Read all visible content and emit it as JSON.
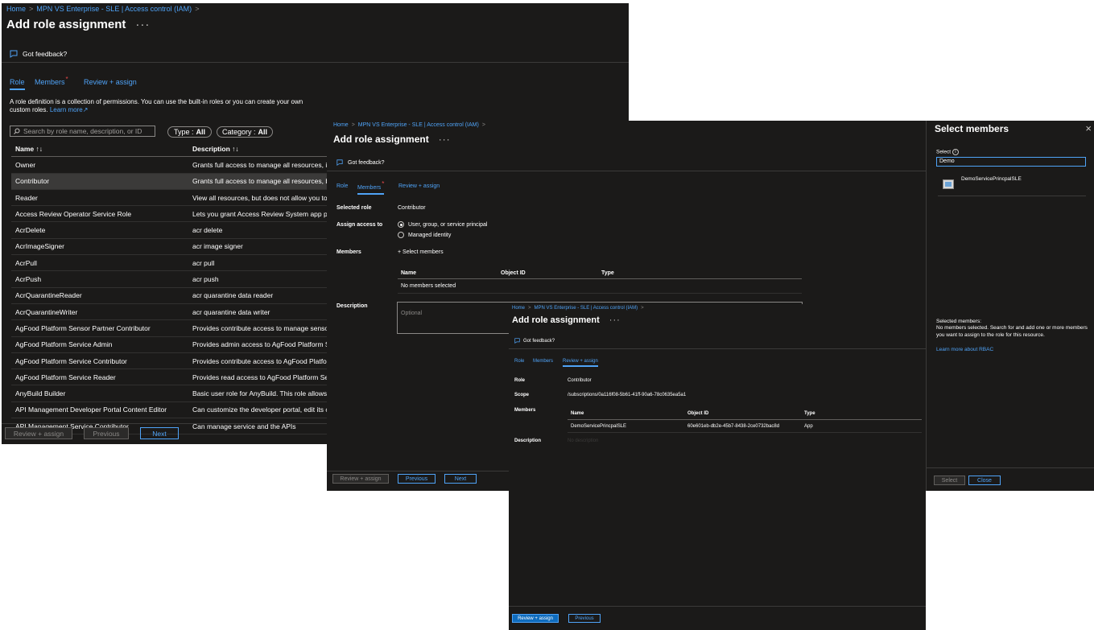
{
  "panel1": {
    "breadcrumb": [
      "Home",
      "MPN VS Enterprise - SLE | Access control (IAM)"
    ],
    "title": "Add role assignment",
    "ellipsis": "···",
    "feedback": "Got feedback?",
    "tabs": {
      "role": "Role",
      "members": "Members",
      "review": "Review + assign"
    },
    "intro": "A role definition is a collection of permissions. You can use the built-in roles or you can create your own custom roles.",
    "learn_more": "Learn more",
    "search_placeholder": "Search by role name, description, or ID",
    "filter_type": {
      "label": "Type :",
      "value": "All"
    },
    "filter_category": {
      "label": "Category :",
      "value": "All"
    },
    "columns": {
      "name": "Name ↑↓",
      "description": "Description ↑↓"
    },
    "rows": [
      {
        "name": "Owner",
        "description": "Grants full access to manage all resources, incluc"
      },
      {
        "name": "Contributor",
        "description": "Grants full access to manage all resources, but d"
      },
      {
        "name": "Reader",
        "description": "View all resources, but does not allow you to ma"
      },
      {
        "name": "Access Review Operator Service Role",
        "description": "Lets you grant Access Review System app permis"
      },
      {
        "name": "AcrDelete",
        "description": "acr delete"
      },
      {
        "name": "AcrImageSigner",
        "description": "acr image signer"
      },
      {
        "name": "AcrPull",
        "description": "acr pull"
      },
      {
        "name": "AcrPush",
        "description": "acr push"
      },
      {
        "name": "AcrQuarantineReader",
        "description": "acr quarantine data reader"
      },
      {
        "name": "AcrQuarantineWriter",
        "description": "acr quarantine data writer"
      },
      {
        "name": "AgFood Platform Sensor Partner Contributor",
        "description": "Provides contribute access to manage sensor rel"
      },
      {
        "name": "AgFood Platform Service Admin",
        "description": "Provides admin access to AgFood Platform Servi"
      },
      {
        "name": "AgFood Platform Service Contributor",
        "description": "Provides contribute access to AgFood Platform S"
      },
      {
        "name": "AgFood Platform Service Reader",
        "description": "Provides read access to AgFood Platform Service"
      },
      {
        "name": "AnyBuild Builder",
        "description": "Basic user role for AnyBuild. This role allows listi"
      },
      {
        "name": "API Management Developer Portal Content Editor",
        "description": "Can customize the developer portal, edit its cont"
      },
      {
        "name": "API Management Service Contributor",
        "description": "Can manage service and the APIs"
      }
    ],
    "buttons": {
      "review": "Review + assign",
      "previous": "Previous",
      "next": "Next"
    }
  },
  "panel2": {
    "breadcrumb": [
      "Home",
      "MPN VS Enterprise - SLE | Access control (IAM)"
    ],
    "title": "Add role assignment",
    "ellipsis": "···",
    "feedback": "Got feedback?",
    "tabs": {
      "role": "Role",
      "members": "Members",
      "review": "Review + assign"
    },
    "selected_role_label": "Selected role",
    "selected_role_value": "Contributor",
    "assign_access_label": "Assign access to",
    "option_user": "User, group, or service principal",
    "option_managed": "Managed identity",
    "members_label": "Members",
    "select_members_link": "+ Select members",
    "columns": {
      "name": "Name",
      "object_id": "Object ID",
      "type": "Type"
    },
    "empty": "No members selected",
    "description_label": "Description",
    "description_placeholder": "Optional",
    "buttons": {
      "review": "Review + assign",
      "previous": "Previous",
      "next": "Next"
    }
  },
  "panel3": {
    "breadcrumb": [
      "Home",
      "MPN VS Enterprise - SLE | Access control (IAM)"
    ],
    "title": "Add role assignment",
    "ellipsis": "···",
    "feedback": "Got feedback?",
    "tabs": {
      "role": "Role",
      "members": "Members",
      "review": "Review + assign"
    },
    "role_label": "Role",
    "role_value": "Contributor",
    "scope_label": "Scope",
    "scope_value": "/subscriptions/0a116f08-5b61-41ff-90a6-78c0635ea5a1",
    "members_label": "Members",
    "columns": {
      "name": "Name",
      "object_id": "Object ID",
      "type": "Type"
    },
    "member_row": {
      "name": "DemoServicePrincpalSLE",
      "object_id": "60e601eb-db2e-45b7-8438-2ce0732bac8d",
      "type": "App"
    },
    "description_label": "Description",
    "description_value": "No description",
    "buttons": {
      "review": "Review + assign",
      "previous": "Previous"
    }
  },
  "panel4": {
    "title": "Select members",
    "close_glyph": "×",
    "select_label": "Select",
    "search_value": "Demo",
    "result_name": "DemoServicePrincpalSLE",
    "selected_heading": "Selected members:",
    "selected_text": "No members selected. Search for and add one or more members you want to assign to the role for this resource.",
    "learn_rbac": "Learn more about RBAC",
    "buttons": {
      "select": "Select",
      "close": "Close"
    }
  }
}
